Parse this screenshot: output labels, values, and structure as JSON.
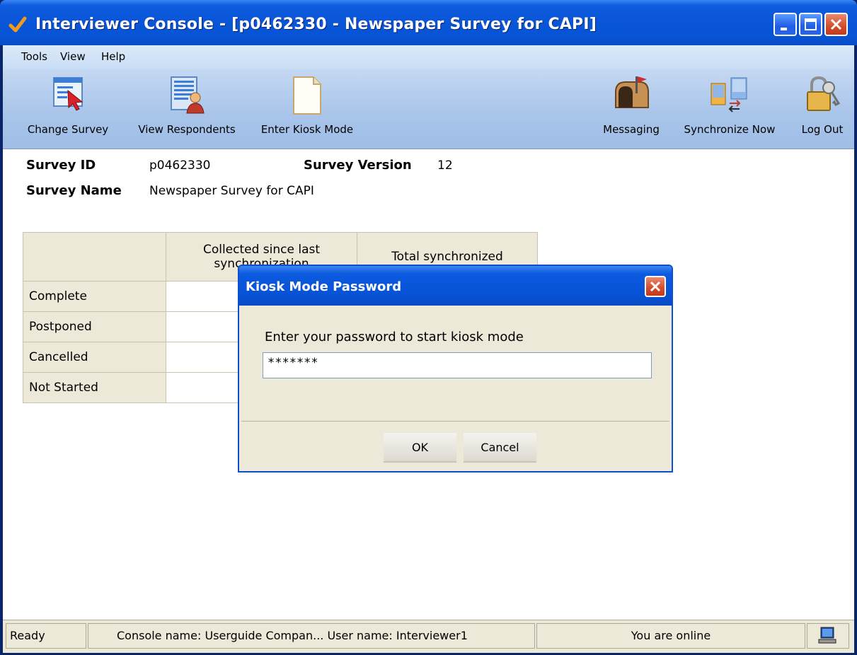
{
  "window": {
    "title": "Interviewer Console - [p0462330 - Newspaper Survey for CAPI]"
  },
  "menu": {
    "items": [
      "Tools",
      "View",
      "Help"
    ]
  },
  "toolbar": {
    "change_survey": "Change Survey",
    "view_respondents": "View Respondents",
    "enter_kiosk_mode": "Enter Kiosk Mode",
    "messaging": "Messaging",
    "synchronize_now": "Synchronize Now",
    "log_out": "Log Out"
  },
  "survey": {
    "id_label": "Survey ID",
    "id_value": "p0462330",
    "version_label": "Survey Version",
    "version_value": "12",
    "name_label": "Survey Name",
    "name_value": "Newspaper Survey for CAPI"
  },
  "stats_table": {
    "col_collected": "Collected since last synchronization",
    "col_total": "Total synchronized",
    "rows": [
      "Complete",
      "Postponed",
      "Cancelled",
      "Not Started"
    ]
  },
  "dialog": {
    "title": "Kiosk Mode Password",
    "prompt": "Enter your password to start kiosk mode",
    "password_value": "*******",
    "ok_label": "OK",
    "cancel_label": "Cancel"
  },
  "statusbar": {
    "ready": "Ready",
    "console_info": "Console name:  Userguide Compan...   User name: Interviewer1",
    "online": "You are online"
  },
  "colors": {
    "titlebar": "#0754d5",
    "toolbar": "#a9c5ea",
    "table_header": "#ece9d8",
    "close_button": "#d44b2a"
  }
}
